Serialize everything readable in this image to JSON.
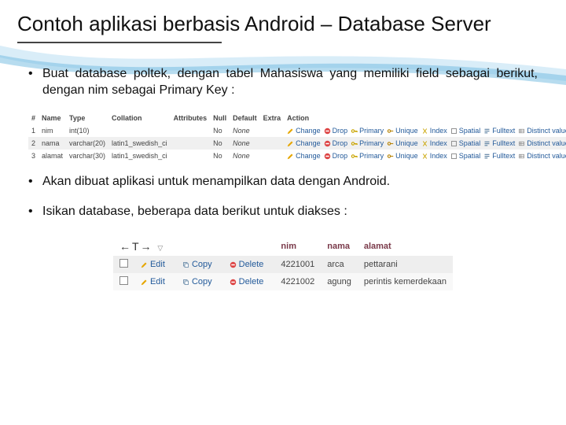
{
  "title": "Contoh aplikasi berbasis Android – Database Server",
  "bullets": {
    "b1": "Buat database poltek, dengan tabel Mahasiswa yang memiliki field sebagai berikut, dengan nim sebagai Primary Key :",
    "b2": "Akan dibuat aplikasi untuk menampilkan data dengan Android.",
    "b3": "Isikan database, beberapa data berikut untuk diakses :"
  },
  "structure": {
    "headers": {
      "num": "#",
      "name": "Name",
      "type": "Type",
      "collation": "Collation",
      "attributes": "Attributes",
      "null": "Null",
      "default": "Default",
      "extra": "Extra",
      "action": "Action"
    },
    "actions": {
      "change": "Change",
      "drop": "Drop",
      "primary": "Primary",
      "unique": "Unique",
      "index": "Index",
      "spatial": "Spatial",
      "fulltext": "Fulltext",
      "distinct": "Distinct values"
    },
    "rows": [
      {
        "num": "1",
        "name": "nim",
        "type": "int(10)",
        "collation": "",
        "null": "No",
        "default": "None"
      },
      {
        "num": "2",
        "name": "nama",
        "type": "varchar(20)",
        "collation": "latin1_swedish_ci",
        "null": "No",
        "default": "None"
      },
      {
        "num": "3",
        "name": "alamat",
        "type": "varchar(30)",
        "collation": "latin1_swedish_ci",
        "null": "No",
        "default": "None"
      }
    ]
  },
  "dataTable": {
    "opsHeader": "←T→",
    "columns": {
      "nim": "nim",
      "nama": "nama",
      "alamat": "alamat"
    },
    "actions": {
      "edit": "Edit",
      "copy": "Copy",
      "delete": "Delete"
    },
    "rows": [
      {
        "nim": "4221001",
        "nama": "arca",
        "alamat": "pettarani"
      },
      {
        "nim": "4221002",
        "nama": "agung",
        "alamat": "perintis kemerdekaan"
      }
    ]
  }
}
